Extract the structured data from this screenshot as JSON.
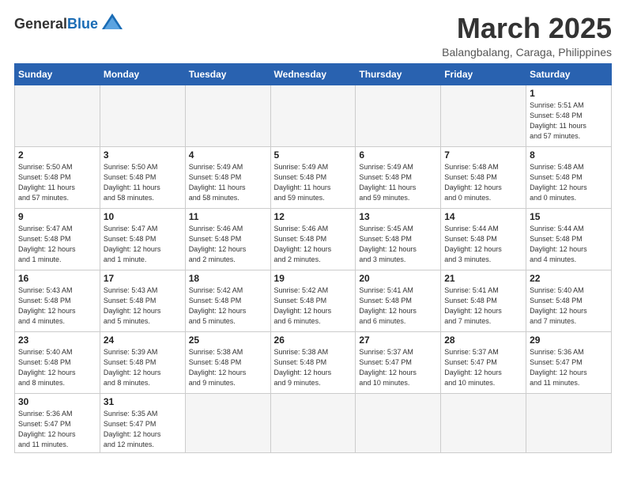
{
  "header": {
    "logo_general": "General",
    "logo_blue": "Blue",
    "month_title": "March 2025",
    "subtitle": "Balangbalang, Caraga, Philippines"
  },
  "weekdays": [
    "Sunday",
    "Monday",
    "Tuesday",
    "Wednesday",
    "Thursday",
    "Friday",
    "Saturday"
  ],
  "days": [
    {
      "num": "",
      "info": ""
    },
    {
      "num": "",
      "info": ""
    },
    {
      "num": "",
      "info": ""
    },
    {
      "num": "",
      "info": ""
    },
    {
      "num": "",
      "info": ""
    },
    {
      "num": "",
      "info": ""
    },
    {
      "num": "1",
      "info": "Sunrise: 5:51 AM\nSunset: 5:48 PM\nDaylight: 11 hours\nand 57 minutes."
    },
    {
      "num": "2",
      "info": "Sunrise: 5:50 AM\nSunset: 5:48 PM\nDaylight: 11 hours\nand 57 minutes."
    },
    {
      "num": "3",
      "info": "Sunrise: 5:50 AM\nSunset: 5:48 PM\nDaylight: 11 hours\nand 58 minutes."
    },
    {
      "num": "4",
      "info": "Sunrise: 5:49 AM\nSunset: 5:48 PM\nDaylight: 11 hours\nand 58 minutes."
    },
    {
      "num": "5",
      "info": "Sunrise: 5:49 AM\nSunset: 5:48 PM\nDaylight: 11 hours\nand 59 minutes."
    },
    {
      "num": "6",
      "info": "Sunrise: 5:49 AM\nSunset: 5:48 PM\nDaylight: 11 hours\nand 59 minutes."
    },
    {
      "num": "7",
      "info": "Sunrise: 5:48 AM\nSunset: 5:48 PM\nDaylight: 12 hours\nand 0 minutes."
    },
    {
      "num": "8",
      "info": "Sunrise: 5:48 AM\nSunset: 5:48 PM\nDaylight: 12 hours\nand 0 minutes."
    },
    {
      "num": "9",
      "info": "Sunrise: 5:47 AM\nSunset: 5:48 PM\nDaylight: 12 hours\nand 1 minute."
    },
    {
      "num": "10",
      "info": "Sunrise: 5:47 AM\nSunset: 5:48 PM\nDaylight: 12 hours\nand 1 minute."
    },
    {
      "num": "11",
      "info": "Sunrise: 5:46 AM\nSunset: 5:48 PM\nDaylight: 12 hours\nand 2 minutes."
    },
    {
      "num": "12",
      "info": "Sunrise: 5:46 AM\nSunset: 5:48 PM\nDaylight: 12 hours\nand 2 minutes."
    },
    {
      "num": "13",
      "info": "Sunrise: 5:45 AM\nSunset: 5:48 PM\nDaylight: 12 hours\nand 3 minutes."
    },
    {
      "num": "14",
      "info": "Sunrise: 5:44 AM\nSunset: 5:48 PM\nDaylight: 12 hours\nand 3 minutes."
    },
    {
      "num": "15",
      "info": "Sunrise: 5:44 AM\nSunset: 5:48 PM\nDaylight: 12 hours\nand 4 minutes."
    },
    {
      "num": "16",
      "info": "Sunrise: 5:43 AM\nSunset: 5:48 PM\nDaylight: 12 hours\nand 4 minutes."
    },
    {
      "num": "17",
      "info": "Sunrise: 5:43 AM\nSunset: 5:48 PM\nDaylight: 12 hours\nand 5 minutes."
    },
    {
      "num": "18",
      "info": "Sunrise: 5:42 AM\nSunset: 5:48 PM\nDaylight: 12 hours\nand 5 minutes."
    },
    {
      "num": "19",
      "info": "Sunrise: 5:42 AM\nSunset: 5:48 PM\nDaylight: 12 hours\nand 6 minutes."
    },
    {
      "num": "20",
      "info": "Sunrise: 5:41 AM\nSunset: 5:48 PM\nDaylight: 12 hours\nand 6 minutes."
    },
    {
      "num": "21",
      "info": "Sunrise: 5:41 AM\nSunset: 5:48 PM\nDaylight: 12 hours\nand 7 minutes."
    },
    {
      "num": "22",
      "info": "Sunrise: 5:40 AM\nSunset: 5:48 PM\nDaylight: 12 hours\nand 7 minutes."
    },
    {
      "num": "23",
      "info": "Sunrise: 5:40 AM\nSunset: 5:48 PM\nDaylight: 12 hours\nand 8 minutes."
    },
    {
      "num": "24",
      "info": "Sunrise: 5:39 AM\nSunset: 5:48 PM\nDaylight: 12 hours\nand 8 minutes."
    },
    {
      "num": "25",
      "info": "Sunrise: 5:38 AM\nSunset: 5:48 PM\nDaylight: 12 hours\nand 9 minutes."
    },
    {
      "num": "26",
      "info": "Sunrise: 5:38 AM\nSunset: 5:48 PM\nDaylight: 12 hours\nand 9 minutes."
    },
    {
      "num": "27",
      "info": "Sunrise: 5:37 AM\nSunset: 5:47 PM\nDaylight: 12 hours\nand 10 minutes."
    },
    {
      "num": "28",
      "info": "Sunrise: 5:37 AM\nSunset: 5:47 PM\nDaylight: 12 hours\nand 10 minutes."
    },
    {
      "num": "29",
      "info": "Sunrise: 5:36 AM\nSunset: 5:47 PM\nDaylight: 12 hours\nand 11 minutes."
    },
    {
      "num": "30",
      "info": "Sunrise: 5:36 AM\nSunset: 5:47 PM\nDaylight: 12 hours\nand 11 minutes."
    },
    {
      "num": "31",
      "info": "Sunrise: 5:35 AM\nSunset: 5:47 PM\nDaylight: 12 hours\nand 12 minutes."
    }
  ]
}
